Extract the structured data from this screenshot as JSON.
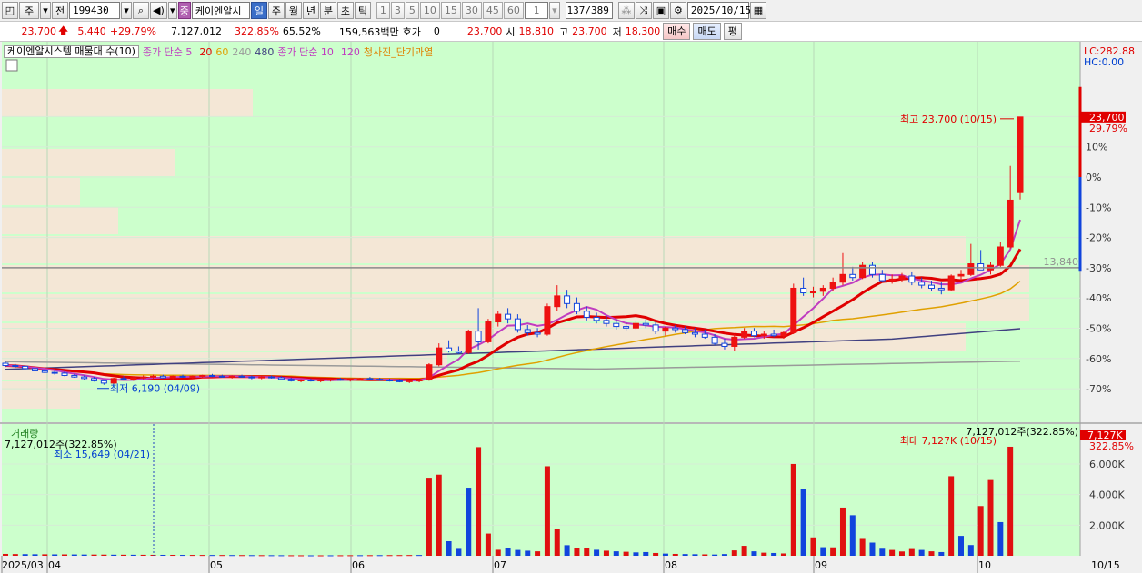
{
  "toolbar": {
    "market": "주",
    "all_label": "전",
    "code": "199430",
    "badge": "중",
    "name": "케이엔알시",
    "periods": [
      "일",
      "주",
      "월",
      "년",
      "분",
      "초",
      "틱"
    ],
    "intervals": [
      "1",
      "3",
      "5",
      "10",
      "15",
      "30",
      "45",
      "60"
    ],
    "custom_interval": "1",
    "bar_count": "137/389",
    "date": "2025/10/15"
  },
  "quote": {
    "price": "23,700",
    "change": "5,440",
    "rate": "+29.79%",
    "volume": "7,127,012",
    "volume_ratio": "322.85%",
    "turnover": "65.52%",
    "amount": "159,563백만",
    "hoga_label": "호가",
    "hoga_value": "0",
    "hoga_price": "23,700",
    "open_label": "시",
    "open": "18,810",
    "high_label": "고",
    "high": "23,700",
    "low_label": "저",
    "low": "18,300",
    "buy_label": "매수",
    "sell_label": "매도",
    "eval_label": "평"
  },
  "chart_data": {
    "type": "candlestick",
    "legend": {
      "profile": "케이엔알시스템 매물대 수(10)",
      "ma_price_label": "종가 단순 5",
      "ma5": "",
      "ma20": "20",
      "ma60": "60",
      "ma240": "240",
      "ma480": "480",
      "vma_label": "종가 단순 10",
      "vma10": "",
      "vma120": "120",
      "signal": "청사진_단기과열"
    },
    "lc_label": "LC:282.88",
    "hc_label": "HC:0.00",
    "price_label": "23,700",
    "price_pct_label": "29.79%",
    "ref_line_value": 13840,
    "ref_line_label": "13,840",
    "max_label": "최고 23,700 (10/15)",
    "min_label": "최저 6,190 (04/09)",
    "pct_axis": [
      20,
      10,
      0,
      -10,
      -20,
      -30,
      -40,
      -50,
      -60,
      -70
    ],
    "pct_axis_labels": [
      "20%",
      "10%",
      "0%",
      "-10%",
      "-20%",
      "-30%",
      "-40%",
      "-50%",
      "-60%",
      "-70%"
    ],
    "months": [
      "2025/03",
      "04",
      "05",
      "06",
      "07",
      "08",
      "09",
      "10"
    ],
    "x_end_label": "10/15",
    "volume_panel": {
      "title": "거래량",
      "current": "7,127,012주(322.85%)",
      "current_right": "7,127,012주(322.85%)",
      "min_label": "최소 15,649 (04/21)",
      "max_label": "최대 7,127K (10/15)",
      "badge_value": "7,127K",
      "badge_pct": "322.85%",
      "axis": [
        "6,000K",
        "4,000K",
        "2,000K"
      ]
    },
    "candles": [
      [
        7600,
        7700,
        7350,
        7450
      ],
      [
        7450,
        7550,
        7300,
        7400
      ],
      [
        7400,
        7450,
        7150,
        7250
      ],
      [
        7250,
        7350,
        7050,
        7100
      ],
      [
        7100,
        7200,
        6950,
        7000
      ],
      [
        7000,
        7100,
        6850,
        6950
      ],
      [
        6950,
        7050,
        6750,
        6800
      ],
      [
        6800,
        6900,
        6650,
        6700
      ],
      [
        6700,
        6800,
        6500,
        6600
      ],
      [
        6600,
        6700,
        6400,
        6450
      ],
      [
        6450,
        6500,
        6190,
        6300
      ],
      [
        6300,
        6650,
        6250,
        6600
      ],
      [
        6600,
        6750,
        6500,
        6550
      ],
      [
        6550,
        6700,
        6450,
        6650
      ],
      [
        6650,
        6800,
        6550,
        6700
      ],
      [
        6700,
        6850,
        6600,
        6750
      ],
      [
        6750,
        6850,
        6600,
        6650
      ],
      [
        6650,
        6800,
        6550,
        6750
      ],
      [
        6750,
        6850,
        6650,
        6700
      ],
      [
        6700,
        6800,
        6600,
        6750
      ],
      [
        6750,
        6850,
        6650,
        6800
      ],
      [
        6800,
        6900,
        6700,
        6750
      ],
      [
        6750,
        6850,
        6650,
        6700
      ],
      [
        6700,
        6800,
        6600,
        6750
      ],
      [
        6750,
        6850,
        6650,
        6700
      ],
      [
        6700,
        6800,
        6550,
        6650
      ],
      [
        6650,
        6750,
        6550,
        6700
      ],
      [
        6700,
        6800,
        6600,
        6650
      ],
      [
        6650,
        6750,
        6500,
        6550
      ],
      [
        6550,
        6650,
        6400,
        6450
      ],
      [
        6450,
        6550,
        6350,
        6500
      ],
      [
        6500,
        6600,
        6400,
        6450
      ],
      [
        6450,
        6550,
        6350,
        6500
      ],
      [
        6500,
        6600,
        6400,
        6550
      ],
      [
        6550,
        6650,
        6450,
        6500
      ],
      [
        6500,
        6600,
        6400,
        6550
      ],
      [
        6550,
        6650,
        6450,
        6600
      ],
      [
        6600,
        6700,
        6500,
        6550
      ],
      [
        6550,
        6650,
        6450,
        6500
      ],
      [
        6500,
        6600,
        6400,
        6450
      ],
      [
        6450,
        6550,
        6350,
        6400
      ],
      [
        6400,
        6500,
        6300,
        6450
      ],
      [
        6450,
        6550,
        6350,
        6500
      ],
      [
        6500,
        7600,
        6450,
        7500
      ],
      [
        7500,
        8900,
        7400,
        8600
      ],
      [
        8600,
        9100,
        8300,
        8400
      ],
      [
        8400,
        8700,
        8200,
        8300
      ],
      [
        8300,
        9800,
        8200,
        9700
      ],
      [
        9700,
        11200,
        8500,
        9000
      ],
      [
        9000,
        10500,
        8900,
        10300
      ],
      [
        10300,
        11000,
        10000,
        10800
      ],
      [
        10800,
        11200,
        10200,
        10500
      ],
      [
        10500,
        10800,
        9600,
        9800
      ],
      [
        9800,
        10100,
        9400,
        9600
      ],
      [
        9600,
        9900,
        9300,
        9500
      ],
      [
        9500,
        11500,
        9400,
        11300
      ],
      [
        11300,
        12700,
        11000,
        12000
      ],
      [
        12000,
        12400,
        11200,
        11500
      ],
      [
        11500,
        11900,
        10800,
        11000
      ],
      [
        11000,
        11300,
        10400,
        10600
      ],
      [
        10600,
        10900,
        10200,
        10400
      ],
      [
        10400,
        10700,
        10000,
        10200
      ],
      [
        10200,
        10500,
        9800,
        10000
      ],
      [
        10000,
        10300,
        9700,
        9900
      ],
      [
        9900,
        10400,
        9800,
        10200
      ],
      [
        10200,
        10500,
        9900,
        10100
      ],
      [
        10100,
        10300,
        9500,
        9700
      ],
      [
        9700,
        10000,
        9400,
        9900
      ],
      [
        9900,
        10100,
        9600,
        9800
      ],
      [
        9800,
        10000,
        9500,
        9600
      ],
      [
        9600,
        9900,
        9300,
        9500
      ],
      [
        9500,
        9800,
        9200,
        9300
      ],
      [
        9300,
        9500,
        8800,
        8900
      ],
      [
        8900,
        9200,
        8500,
        8700
      ],
      [
        8700,
        9500,
        8400,
        9300
      ],
      [
        9300,
        9900,
        9200,
        9700
      ],
      [
        9700,
        9900,
        9300,
        9400
      ],
      [
        9400,
        9700,
        9200,
        9500
      ],
      [
        9500,
        9800,
        9300,
        9400
      ],
      [
        9400,
        9700,
        9200,
        9600
      ],
      [
        9600,
        12800,
        9500,
        12500
      ],
      [
        12500,
        13200,
        12000,
        12200
      ],
      [
        12200,
        12600,
        11900,
        12300
      ],
      [
        12300,
        12700,
        12000,
        12500
      ],
      [
        12500,
        13200,
        12300,
        12900
      ],
      [
        12900,
        14800,
        12700,
        13400
      ],
      [
        13400,
        13900,
        13000,
        13200
      ],
      [
        13200,
        14200,
        13100,
        14000
      ],
      [
        14000,
        14200,
        13200,
        13400
      ],
      [
        13400,
        13700,
        12900,
        13000
      ],
      [
        13000,
        13400,
        12800,
        13100
      ],
      [
        13100,
        13500,
        12900,
        13300
      ],
      [
        13300,
        13600,
        12700,
        12900
      ],
      [
        12900,
        13200,
        12500,
        12700
      ],
      [
        12700,
        13000,
        12300,
        12500
      ],
      [
        12500,
        12900,
        12100,
        12400
      ],
      [
        12400,
        13400,
        12300,
        13300
      ],
      [
        13300,
        13700,
        13000,
        13400
      ],
      [
        13400,
        15400,
        13300,
        14100
      ],
      [
        14100,
        15000,
        13800,
        13700
      ],
      [
        13700,
        14200,
        13400,
        14000
      ],
      [
        14000,
        15500,
        13900,
        15200
      ],
      [
        15200,
        20500,
        15100,
        18260
      ],
      [
        18810,
        23700,
        18300,
        23700
      ]
    ],
    "volume": [
      [
        120,
        1
      ],
      [
        110,
        1
      ],
      [
        105,
        0
      ],
      [
        98,
        0
      ],
      [
        95,
        1
      ],
      [
        90,
        0
      ],
      [
        88,
        1
      ],
      [
        85,
        0
      ],
      [
        80,
        0
      ],
      [
        78,
        1
      ],
      [
        75,
        1
      ],
      [
        70,
        0
      ],
      [
        68,
        1
      ],
      [
        66,
        0
      ],
      [
        64,
        1
      ],
      [
        62,
        1
      ],
      [
        60,
        0
      ],
      [
        58,
        1
      ],
      [
        56,
        0
      ],
      [
        54,
        1
      ],
      [
        52,
        1
      ],
      [
        50,
        0
      ],
      [
        48,
        1
      ],
      [
        46,
        0
      ],
      [
        44,
        1
      ],
      [
        42,
        0
      ],
      [
        40,
        1
      ],
      [
        38,
        0
      ],
      [
        36,
        0
      ],
      [
        34,
        1
      ],
      [
        32,
        1
      ],
      [
        30,
        0
      ],
      [
        30,
        1
      ],
      [
        32,
        0
      ],
      [
        34,
        1
      ],
      [
        36,
        1
      ],
      [
        38,
        0
      ],
      [
        40,
        1
      ],
      [
        42,
        0
      ],
      [
        44,
        1
      ],
      [
        46,
        1
      ],
      [
        48,
        1
      ],
      [
        50,
        0
      ],
      [
        5100,
        1
      ],
      [
        5300,
        1
      ],
      [
        950,
        0
      ],
      [
        450,
        0
      ],
      [
        4450,
        0
      ],
      [
        7100,
        1
      ],
      [
        1450,
        1
      ],
      [
        390,
        1
      ],
      [
        480,
        0
      ],
      [
        380,
        0
      ],
      [
        330,
        0
      ],
      [
        290,
        1
      ],
      [
        5850,
        1
      ],
      [
        1750,
        1
      ],
      [
        690,
        0
      ],
      [
        530,
        1
      ],
      [
        490,
        1
      ],
      [
        390,
        0
      ],
      [
        330,
        1
      ],
      [
        290,
        0
      ],
      [
        260,
        1
      ],
      [
        220,
        0
      ],
      [
        240,
        0
      ],
      [
        180,
        1
      ],
      [
        140,
        0
      ],
      [
        120,
        1
      ],
      [
        110,
        0
      ],
      [
        100,
        0
      ],
      [
        90,
        1
      ],
      [
        80,
        0
      ],
      [
        110,
        0
      ],
      [
        350,
        1
      ],
      [
        650,
        1
      ],
      [
        290,
        0
      ],
      [
        200,
        1
      ],
      [
        180,
        0
      ],
      [
        150,
        1
      ],
      [
        6000,
        1
      ],
      [
        4350,
        0
      ],
      [
        1200,
        1
      ],
      [
        560,
        0
      ],
      [
        550,
        1
      ],
      [
        3150,
        1
      ],
      [
        2650,
        0
      ],
      [
        1100,
        1
      ],
      [
        860,
        0
      ],
      [
        460,
        0
      ],
      [
        380,
        1
      ],
      [
        280,
        1
      ],
      [
        440,
        1
      ],
      [
        380,
        0
      ],
      [
        290,
        1
      ],
      [
        240,
        0
      ],
      [
        5200,
        1
      ],
      [
        1300,
        0
      ],
      [
        700,
        0
      ],
      [
        3250,
        1
      ],
      [
        4950,
        1
      ],
      [
        2200,
        0
      ],
      [
        7127,
        1
      ]
    ]
  }
}
